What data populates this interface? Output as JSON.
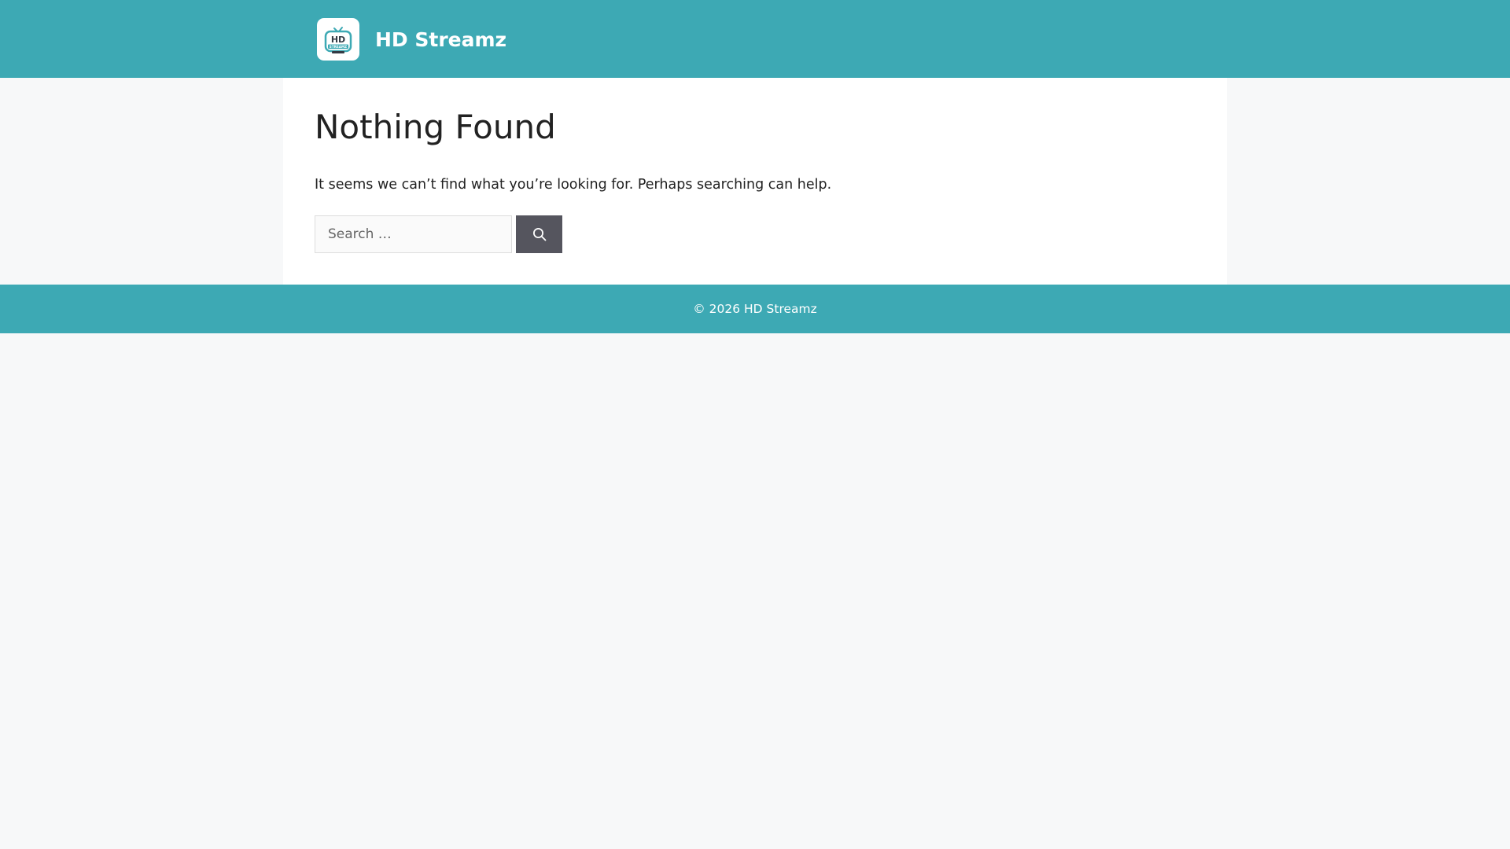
{
  "header": {
    "site_title": "HD Streamz",
    "logo_icon": "hd-streamz-tv-logo",
    "background_color": "#3da9b4"
  },
  "main": {
    "title": "Nothing Found",
    "message": "It seems we can’t find what you’re looking for. Perhaps searching can help.",
    "search": {
      "placeholder": "Search …",
      "value": "",
      "button_icon": "search-icon"
    }
  },
  "footer": {
    "copyright": "© 2026 HD Streamz"
  },
  "colors": {
    "accent": "#3da9b4",
    "button": "#55555e",
    "page_background": "#f7f8f9",
    "content_background": "#ffffff"
  }
}
